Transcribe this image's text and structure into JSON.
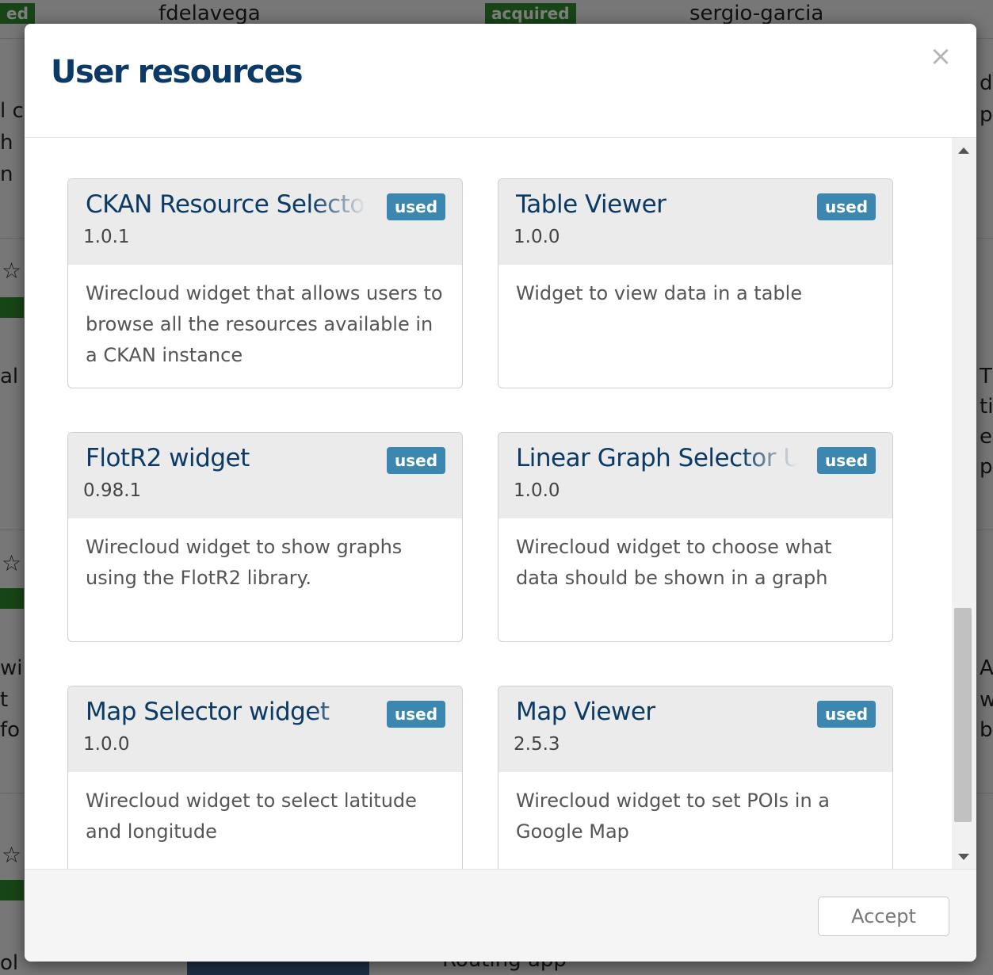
{
  "background": {
    "top_left_badge": "ed",
    "top_user": "fdelavega",
    "acquired_badge": "acquired",
    "top_right_user": "sergio-garcia",
    "left_fragments": [
      "l c",
      "h",
      "n",
      "al",
      "wi",
      "t",
      "fo"
    ],
    "right_fragments": [
      "d",
      "p",
      "T",
      "ti",
      "e",
      "p",
      "A",
      "w",
      "b"
    ],
    "bottom_app": "Routing app",
    "bottom_left": "ol"
  },
  "modal": {
    "title": "User resources",
    "close_glyph": "×",
    "accept_label": "Accept"
  },
  "cards": [
    {
      "title": "CKAN Resource Selector",
      "version": "1.0.1",
      "badge": "used",
      "description": "Wirecloud widget that allows users to browse all the resources available in a CKAN instance"
    },
    {
      "title": "Table Viewer",
      "version": "1.0.0",
      "badge": "used",
      "description": "Widget to view data in a table"
    },
    {
      "title": "FlotR2 widget",
      "version": "0.98.1",
      "badge": "used",
      "description": "Wirecloud widget to show graphs using the FlotR2 library."
    },
    {
      "title": "Linear Graph Selector UI",
      "version": "1.0.0",
      "badge": "used",
      "description": "Wirecloud widget to choose what data should be shown in a graph"
    },
    {
      "title": "Map Selector widget",
      "version": "1.0.0",
      "badge": "used",
      "description": "Wirecloud widget to select latitude and longitude"
    },
    {
      "title": "Map Viewer",
      "version": "2.5.3",
      "badge": "used",
      "description": "Wirecloud widget to set POIs in a Google Map"
    }
  ],
  "colors": {
    "title": "#0b3a66",
    "badge": "#3b87b0",
    "card_header": "#ebebeb",
    "bg_badge": "#2e8b2e"
  }
}
